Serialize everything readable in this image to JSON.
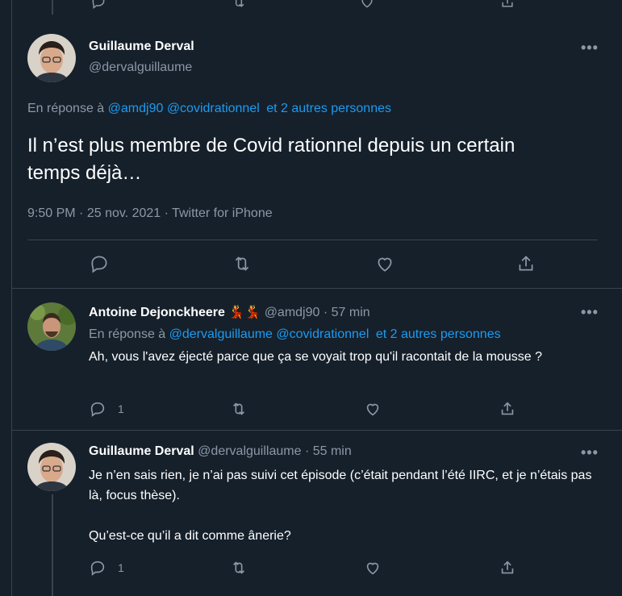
{
  "main_tweet": {
    "author_name": "Guillaume Derval",
    "author_handle": "@dervalguillaume",
    "reply_prefix": "En réponse à",
    "mention_1": "@amdj90",
    "mention_2": "@covidrationnel",
    "mention_more": "et 2 autres personnes",
    "text": "Il n’est plus membre de Covid rationnel depuis un certain temps déjà…",
    "time": "9:50 PM",
    "date": "25 nov. 2021",
    "source": "Twitter for iPhone",
    "sep": "·"
  },
  "reply_1": {
    "author_name": "Antoine Dejonckheere",
    "emoji": "💃💃",
    "author_handle": "@amdj90",
    "time_ago": "57 min",
    "reply_prefix": "En réponse à",
    "mention_1": "@dervalguillaume",
    "mention_2": "@covidrationnel",
    "mention_more": "et 2 autres personnes",
    "text": "Ah, vous l'avez éjecté parce que ça se voyait trop qu'il racontait de la mousse ?",
    "reply_count": "1"
  },
  "reply_2": {
    "author_name": "Guillaume Derval",
    "author_handle": "@dervalguillaume",
    "time_ago": "55 min",
    "text_1": "Je n’en sais rien, je n’ai pas suivi cet épisode (c’était pendant l’été IIRC, et je n’étais pas là, focus thèse).",
    "text_2": "Qu’est-ce qu’il a dit comme ânerie?",
    "reply_count": "1"
  },
  "icons": {
    "reply": "reply-icon",
    "retweet": "retweet-icon",
    "like": "like-icon",
    "share": "share-icon",
    "more": "more-icon"
  },
  "colors": {
    "background": "#15202b",
    "link": "#1d9bf0",
    "muted": "#8b98a5",
    "divider": "#38444d"
  }
}
